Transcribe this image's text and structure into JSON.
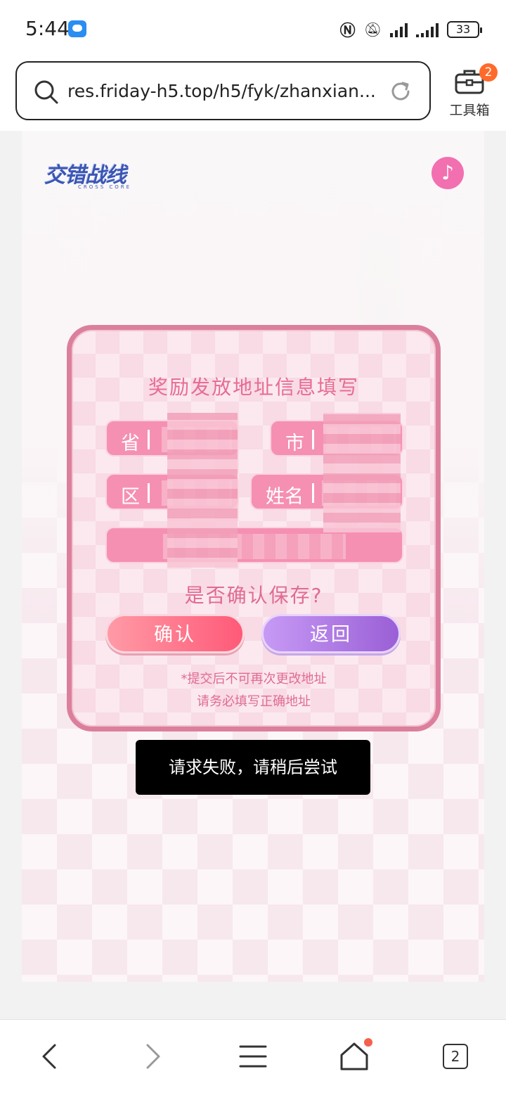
{
  "status_bar": {
    "time": "5:44",
    "battery": "33",
    "icons": [
      "message-icon",
      "nfc-icon",
      "mute-icon",
      "signal-icon",
      "battery-icon"
    ]
  },
  "browser": {
    "url": "res.friday-h5.top/h5/fyk/zhanxian...",
    "toolbox_label": "工具箱",
    "toolbox_badge": "2"
  },
  "page": {
    "logo_text": "交错战线",
    "logo_subtext": "CROSS CORE",
    "music_icon": "♪"
  },
  "dialog": {
    "title": "奖励发放地址信息填写",
    "fields": {
      "province_label": "省",
      "city_label": "市",
      "district_label": "区",
      "name_label": "姓名"
    },
    "question": "是否确认保存?",
    "confirm_label": "确认",
    "back_label": "返回",
    "notice_line1": "*提交后不可再次更改地址",
    "notice_line2": "请务必填写正确地址"
  },
  "toast": {
    "message": "请求失败，请稍后尝试"
  },
  "nav": {
    "tab_count": "2"
  },
  "colors": {
    "accent_pink": "#f590b2",
    "frame_pink": "#db7f9c",
    "confirm_red": "#ff5a78",
    "back_purple": "#9a5fd6",
    "badge_orange": "#ff6a2b"
  }
}
